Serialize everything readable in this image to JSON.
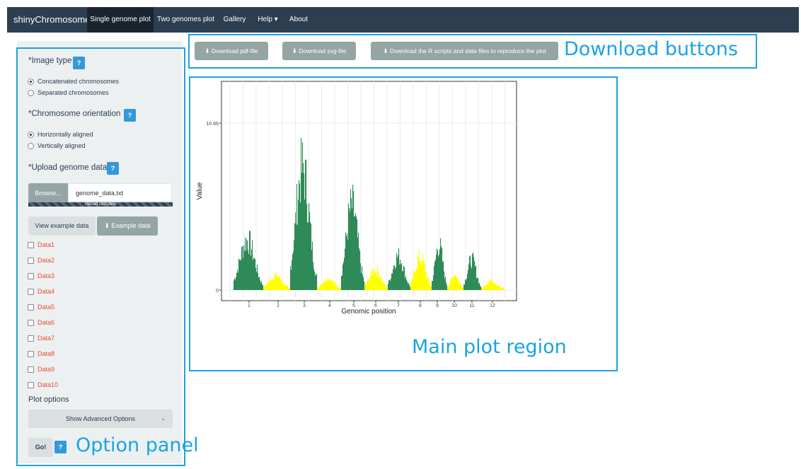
{
  "navbar": {
    "brand": "shinyChromosome",
    "links": [
      {
        "label": "Single genome plot",
        "active": true
      },
      {
        "label": "Two genomes plot",
        "active": false
      },
      {
        "label": "Gallery",
        "active": false
      },
      {
        "label": "Help ▾",
        "active": false
      },
      {
        "label": "About",
        "active": false
      }
    ]
  },
  "sidebar": {
    "image_type_label": "*Image type",
    "help_label": "?",
    "image_type_options": [
      "Concatenated chromosomes",
      "Separated chromosomes"
    ],
    "image_type_selected": "Concatenated chromosomes",
    "orientation_label": "*Chromosome orientation",
    "orientation_options": [
      "Horizontally aligned",
      "Vertically aligned"
    ],
    "orientation_selected": "Horizontally aligned",
    "upload_label": "*Upload genome data",
    "browse_label": "Browse...",
    "file_name": "genome_data.txt",
    "upload_status": "Upload complete",
    "view_example_label": "View example data",
    "example_data_label": "Example data",
    "data_items": [
      "Data1",
      "Data2",
      "Data3",
      "Data4",
      "Data5",
      "Data6",
      "Data7",
      "Data8",
      "Data9",
      "Data10"
    ],
    "plot_options_label": "Plot options",
    "advanced_label": "Show Advanced Options",
    "go_label": "Go!"
  },
  "downloads": {
    "pdf_label": "Download pdf-file",
    "svg_label": "Download svg-file",
    "scripts_label": "Download the R scripts and data files to reproduce the plot"
  },
  "annotations": {
    "download": "Download buttons",
    "plot": "Main plot region",
    "options": "Option panel"
  },
  "colors": {
    "navbar": "#2c3e50",
    "accent_outline": "#1fa2e0",
    "green_series": "#2e8b57",
    "yellow_series": "#ffff00",
    "data_label": "#e74c3c"
  },
  "chart_data": {
    "type": "bar",
    "title": "",
    "xlabel": "Genomic position",
    "ylabel": "Value",
    "x_ticks": [
      "1",
      "2",
      "3",
      "4",
      "5",
      "6",
      "7",
      "8",
      "9",
      "10",
      "11",
      "12"
    ],
    "y_ticks": [
      "0",
      "10.66"
    ],
    "ylim": [
      0,
      12
    ],
    "grid": true,
    "series_colors_by_chromosome": [
      "green",
      "yellow",
      "green",
      "yellow",
      "green",
      "yellow",
      "green",
      "yellow",
      "green",
      "yellow",
      "green",
      "yellow"
    ],
    "chromosome_peaks": [
      {
        "chromosome": "1",
        "peak_value": 4.1
      },
      {
        "chromosome": "2",
        "peak_value": 1.2
      },
      {
        "chromosome": "3",
        "peak_value": 10.0
      },
      {
        "chromosome": "4",
        "peak_value": 1.0
      },
      {
        "chromosome": "5",
        "peak_value": 6.9
      },
      {
        "chromosome": "6",
        "peak_value": 1.7
      },
      {
        "chromosome": "7",
        "peak_value": 2.8
      },
      {
        "chromosome": "8",
        "peak_value": 2.7
      },
      {
        "chromosome": "9",
        "peak_value": 3.7
      },
      {
        "chromosome": "10",
        "peak_value": 1.3
      },
      {
        "chromosome": "11",
        "peak_value": 2.5
      },
      {
        "chromosome": "12",
        "peak_value": 0.8
      }
    ]
  }
}
